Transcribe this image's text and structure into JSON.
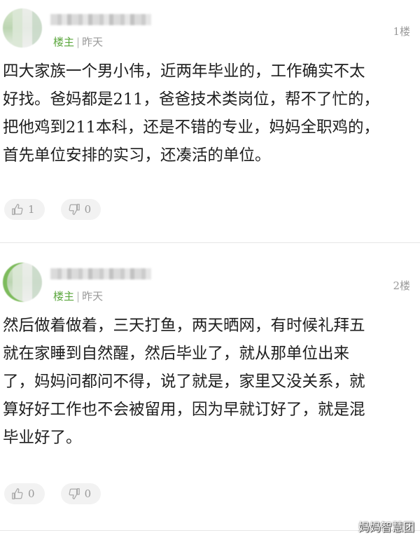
{
  "posts": [
    {
      "op_label": "楼主",
      "separator": "|",
      "time": "昨天",
      "floor": "1楼",
      "lines": [
        "四大家族一个男小伟，近两年毕业的，工作确实不太",
        "好找。爸妈都是211，爸爸技术类岗位，帮不了忙的，",
        "把他鸡到211本科，还是不错的专业，妈妈全职鸡的，",
        "首先单位安排的实习，还凑活的单位。"
      ],
      "likes": "1",
      "dislikes": "0"
    },
    {
      "op_label": "楼主",
      "separator": "|",
      "time": "昨天",
      "floor": "2楼",
      "lines": [
        "然后做着做着，三天打鱼，两天晒网，有时候礼拜五",
        "就在家睡到自然醒，然后毕业了，就从那单位出来",
        "了，妈妈问都问不得，说了就是，家里又没关系，就",
        "算好好工作也不会被留用，因为早就订好了，就是混",
        "毕业好了。"
      ],
      "likes": "0",
      "dislikes": "0"
    }
  ],
  "watermark": "妈妈智慧团",
  "icons": {
    "like": "thumbs-up-icon",
    "dislike": "thumbs-down-icon"
  },
  "colors": {
    "op_label": "#5aa63c",
    "meta": "#999999",
    "vote_bg": "#f2f2f2"
  }
}
